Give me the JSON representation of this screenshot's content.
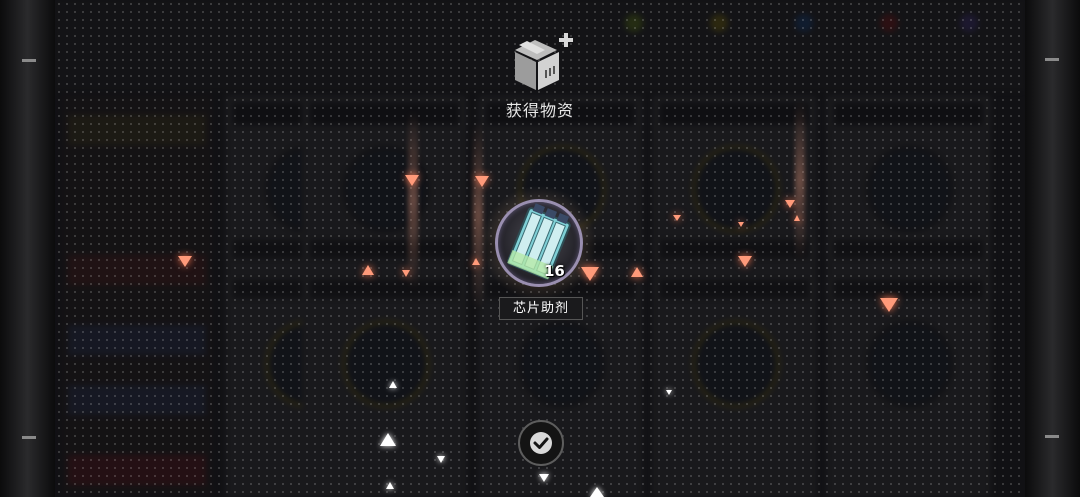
{
  "header": {
    "title": "获得物资",
    "icon": "supply-box-plus-icon"
  },
  "reward": {
    "item_name": "芯片助剂",
    "count": "16",
    "icon": "chip-enhancer-icon"
  },
  "confirm": {
    "icon": "checkmark-icon"
  },
  "colors": {
    "particle": "#ff9a7a",
    "ring": "#9a8fb0",
    "overlay": "#0a0a0c"
  }
}
